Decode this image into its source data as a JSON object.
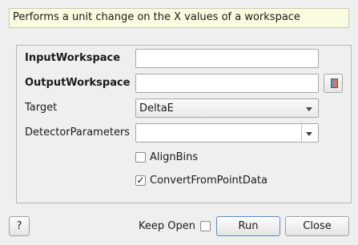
{
  "description": "Performs a unit change on the X values of a workspace",
  "properties": {
    "input_workspace": {
      "label": "InputWorkspace",
      "value": ""
    },
    "output_workspace": {
      "label": "OutputWorkspace",
      "value": ""
    },
    "target": {
      "label": "Target",
      "value": "DeltaE"
    },
    "detector_parameters": {
      "label": "DetectorParameters",
      "value": ""
    },
    "align_bins": {
      "label": "AlignBins",
      "checked": false
    },
    "convert_from_point_data": {
      "label": "ConvertFromPointData",
      "checked": true,
      "mark": "✓"
    }
  },
  "footer": {
    "help_label": "?",
    "keep_open_label": "Keep Open",
    "keep_open_checked": false,
    "run_label": "Run",
    "close_label": "Close"
  },
  "icons": {
    "browse": "workspace-icon",
    "dropdown": "chevron-down-icon"
  }
}
